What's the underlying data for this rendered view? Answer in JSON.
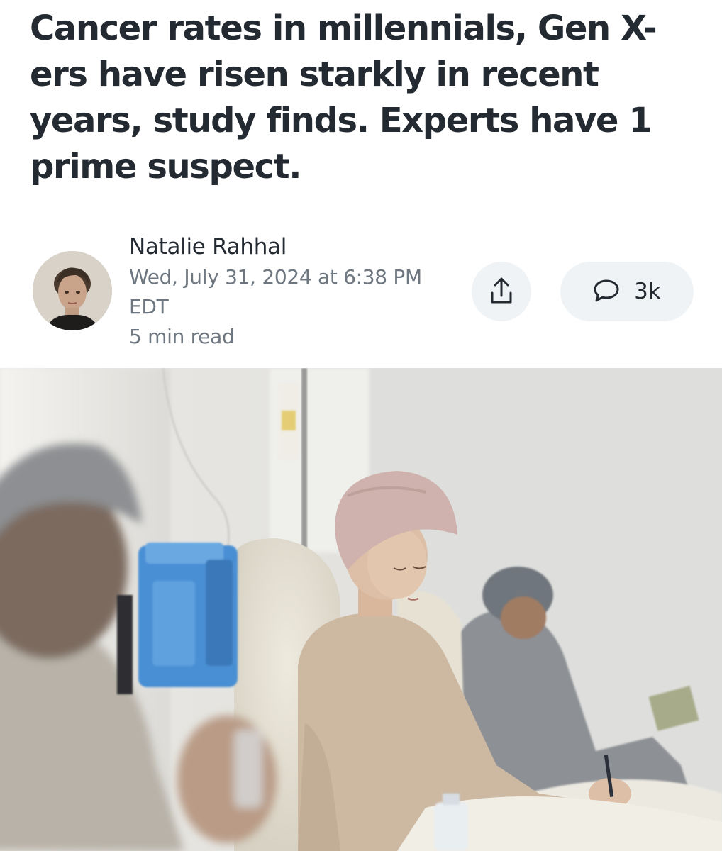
{
  "article": {
    "headline": "Cancer rates in millennials, Gen X-ers have risen starkly in recent years, study finds. Experts have 1 prime suspect.",
    "author": "Natalie Rahhal",
    "date_line1": "Wed, July 31, 2024 at 6:38 PM",
    "date_line2": "EDT",
    "read_time": "5 min read"
  },
  "actions": {
    "share_icon": "share-upload-icon",
    "comments_icon": "speech-bubble-icon",
    "comments_count": "3k"
  },
  "colors": {
    "text_primary": "#232a31",
    "text_secondary": "#6e7780",
    "button_bg": "#f0f3f5"
  }
}
